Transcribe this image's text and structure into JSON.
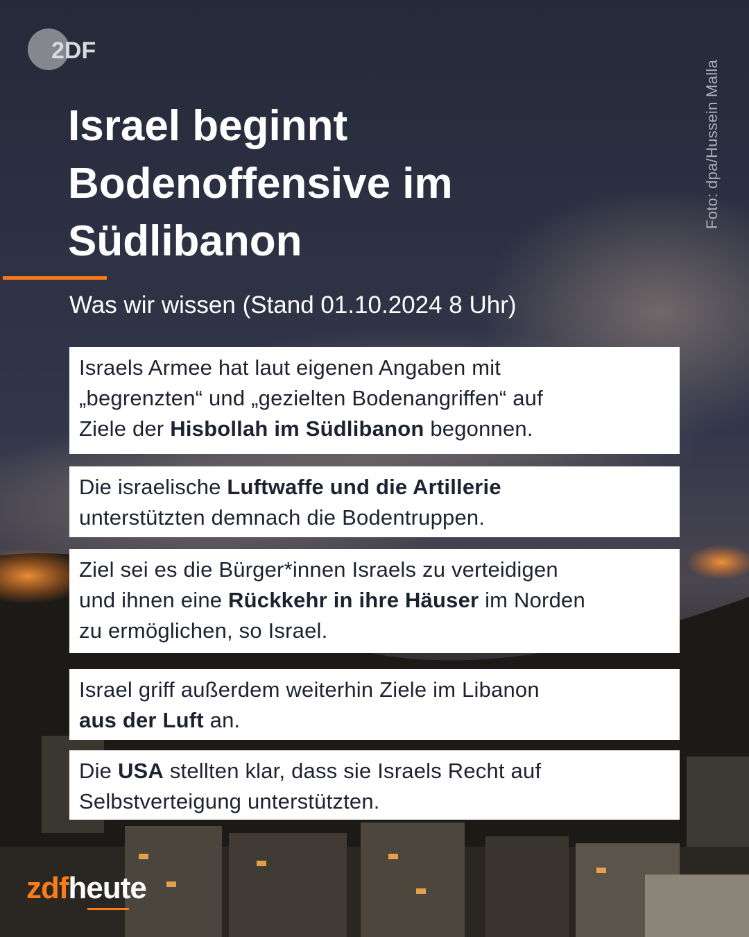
{
  "brand": {
    "top_logo": "2DF",
    "bottom_logo_zdf": "zdf",
    "bottom_logo_heute": "heute"
  },
  "photo_credit": "Foto: dpa/Hussein Malla",
  "title_lines": [
    "Israel beginnt",
    "Bodenoffensive im",
    "Südlibanon"
  ],
  "subtitle": "Was wir wissen (Stand 01.10.2024 8 Uhr)",
  "cards": [
    {
      "lines": [
        [
          {
            "t": "Israels Armee hat laut eigenen Angaben mit"
          }
        ],
        [
          {
            "t": "„begrenzten“ und „gezielten Bodenangriffen“ auf"
          }
        ],
        [
          {
            "t": "Ziele der "
          },
          {
            "t": "Hisbollah im Südlibanon",
            "b": true
          },
          {
            "t": " begonnen."
          }
        ]
      ]
    },
    {
      "lines": [
        [
          {
            "t": "Die israelische "
          },
          {
            "t": "Luftwaffe und die Artillerie",
            "b": true
          }
        ],
        [
          {
            "t": "unterstützten demnach die Bodentruppen."
          }
        ]
      ]
    },
    {
      "lines": [
        [
          {
            "t": "Ziel sei es die Bürger*innen Israels zu verteidigen"
          }
        ],
        [
          {
            "t": "und ihnen eine "
          },
          {
            "t": "Rückkehr in ihre Häuser",
            "b": true
          },
          {
            "t": " im Norden"
          }
        ],
        [
          {
            "t": "zu ermöglichen, so Israel."
          }
        ]
      ]
    },
    {
      "lines": [
        [
          {
            "t": "Israel griff außerdem weiterhin Ziele im Libanon"
          }
        ],
        [
          {
            "t": "aus der Luft",
            "b": true
          },
          {
            "t": " an."
          }
        ]
      ]
    },
    {
      "lines": [
        [
          {
            "t": "Die "
          },
          {
            "t": "USA",
            "b": true
          },
          {
            "t": " stellten klar, dass sie Israels Recht auf"
          }
        ],
        [
          {
            "t": "Selbstverteigung unterstützten."
          }
        ]
      ]
    }
  ],
  "colors": {
    "accent": "#ff7a18",
    "card_bg": "#ffffff",
    "card_text": "#1e2230",
    "title_text": "#ffffff"
  }
}
